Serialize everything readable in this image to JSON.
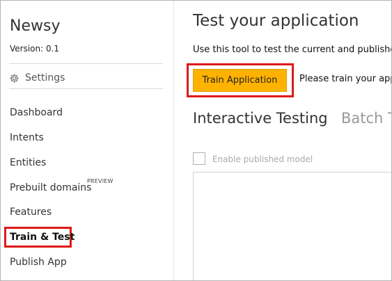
{
  "sidebar": {
    "app_name": "Newsy",
    "version": "Version:  0.1",
    "settings_label": "Settings",
    "items": [
      {
        "label": "Dashboard"
      },
      {
        "label": "Intents"
      },
      {
        "label": "Entities"
      },
      {
        "label": "Prebuilt domains",
        "tag": "PREVIEW"
      },
      {
        "label": "Features"
      },
      {
        "label": "Train & Test"
      },
      {
        "label": "Publish App"
      }
    ]
  },
  "main": {
    "title": "Test your application",
    "description": "Use this tool to test the current and publishe",
    "train_button": "Train Application",
    "train_message": "Please train your app",
    "tabs": [
      {
        "label": "Interactive Testing"
      },
      {
        "label": "Batch T"
      }
    ],
    "enable_published_label": "Enable published model"
  },
  "colors": {
    "train_button": "#ffb300",
    "highlight": "#e01919"
  }
}
